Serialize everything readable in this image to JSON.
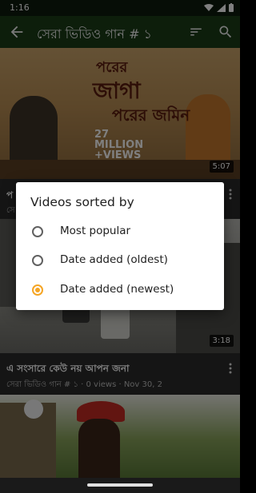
{
  "status_bar": {
    "time": "1:16"
  },
  "app_bar": {
    "title": "সেরা ভিডিও গান # ১"
  },
  "videos": [
    {
      "overlay_top": "পরের",
      "overlay_mid": "জাগা",
      "overlay_sub": "পরের জমিন",
      "views_badge": "27 MILLION +VIEWS",
      "duration": "5:07",
      "title": "প",
      "meta": "সে"
    },
    {
      "duration": "3:18",
      "title": "এ সংসারে কেউ নয় আপন জনা",
      "meta": "সেরা ভিডিও গান # ১  ·  0 views  ·  Nov 30, 2"
    },
    {}
  ],
  "dialog": {
    "title": "Videos sorted by",
    "options": [
      {
        "label": "Most popular",
        "selected": false
      },
      {
        "label": "Date added (oldest)",
        "selected": false
      },
      {
        "label": "Date added (newest)",
        "selected": true
      }
    ]
  },
  "colors": {
    "app_bar": "#1a3c17",
    "accent": "#f5a524",
    "dialog_bg": "#ffffff"
  }
}
